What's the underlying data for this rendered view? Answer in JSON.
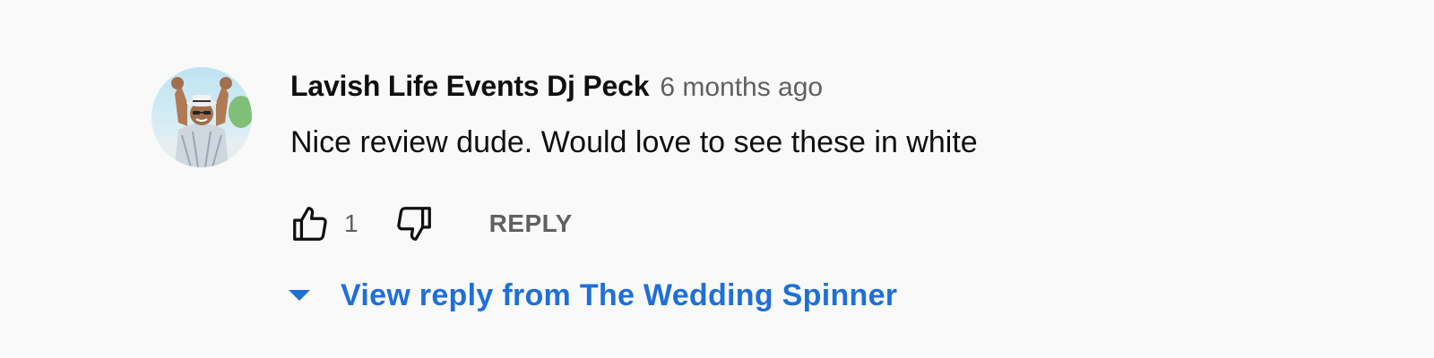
{
  "comment": {
    "author": "Lavish Life Events Dj Peck",
    "timestamp": "6 months ago",
    "text": "Nice review dude. Would love to see these in white",
    "like_count": "1",
    "reply_label": "REPLY",
    "avatar_icon": "user-avatar-photo"
  },
  "replies": {
    "toggle_label": "View reply from The Wedding Spinner",
    "toggle_icon": "caret-down-icon"
  },
  "colors": {
    "background": "#f9f9f9",
    "link_blue": "#1f6fd8",
    "secondary_text": "#606060",
    "primary_text": "#0f0f0f"
  }
}
